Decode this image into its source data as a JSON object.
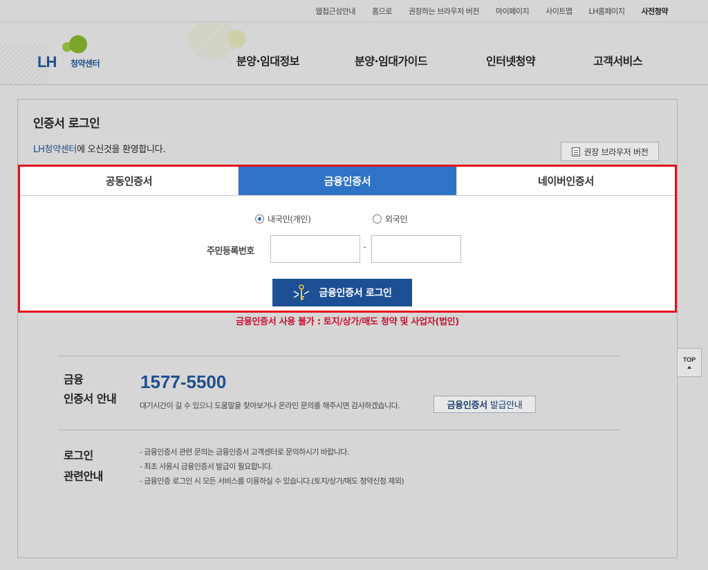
{
  "top_links": [
    "웹접근성안내",
    "홈으로",
    "권장하는 브라우저 버전",
    "마이페이지",
    "사이트맵",
    "LH홈페이지",
    "사전청약"
  ],
  "logo": {
    "main": "LH",
    "sub": "청약센터"
  },
  "nav": [
    "분양·임대정보",
    "분양·임대가이드",
    "인터넷청약",
    "고객서비스"
  ],
  "page": {
    "title": "인증서 로그인",
    "welcome_brand": "LH청약센터",
    "welcome_rest": "에 오신것을 환영합니다.",
    "browser_button": "권장 브라우저 버전"
  },
  "login": {
    "tabs": [
      "공동인증서",
      "금융인증서",
      "네이버인증서"
    ],
    "active_tab": 1,
    "radio_domestic": "내국인(개인)",
    "radio_foreign": "외국인",
    "id_label": "주민등록번호",
    "id_dash": "-",
    "login_button": "금융인증서 로그인"
  },
  "warning": "금융인증서 사용 불가 : 토지/상가/매도 청약 및 사업자(법인)",
  "cert_info": {
    "title_line1": "금융",
    "title_line2": "인증서 안내",
    "phone": "1577-5500",
    "desc": "대기시간이 길 수 있으니 도움말을 찾아보거나 온라인 문의를 해주시면 감사하겠습니다.",
    "guide_bold": "금융인증서",
    "guide_rest": "발급안내"
  },
  "login_info": {
    "title_line1": "로그인",
    "title_line2": "관련안내",
    "items": [
      "- 금융인증서 관련 문의는 금융인증서 고객센터로 문의하시기 바랍니다.",
      "- 최초 사용시 금융인증서 발급이 필요합니다.",
      "- 금융인증 로그인 시 모든 서비스를 이용하실 수 있습니다.(토지/상가/매도 청약신청 제외)"
    ]
  },
  "top_button": "TOP",
  "colors": {
    "accent_blue": "#2f73c6",
    "button_navy": "#1d4f94",
    "warning_red": "#c8102e",
    "highlight_border": "#e3111b"
  }
}
